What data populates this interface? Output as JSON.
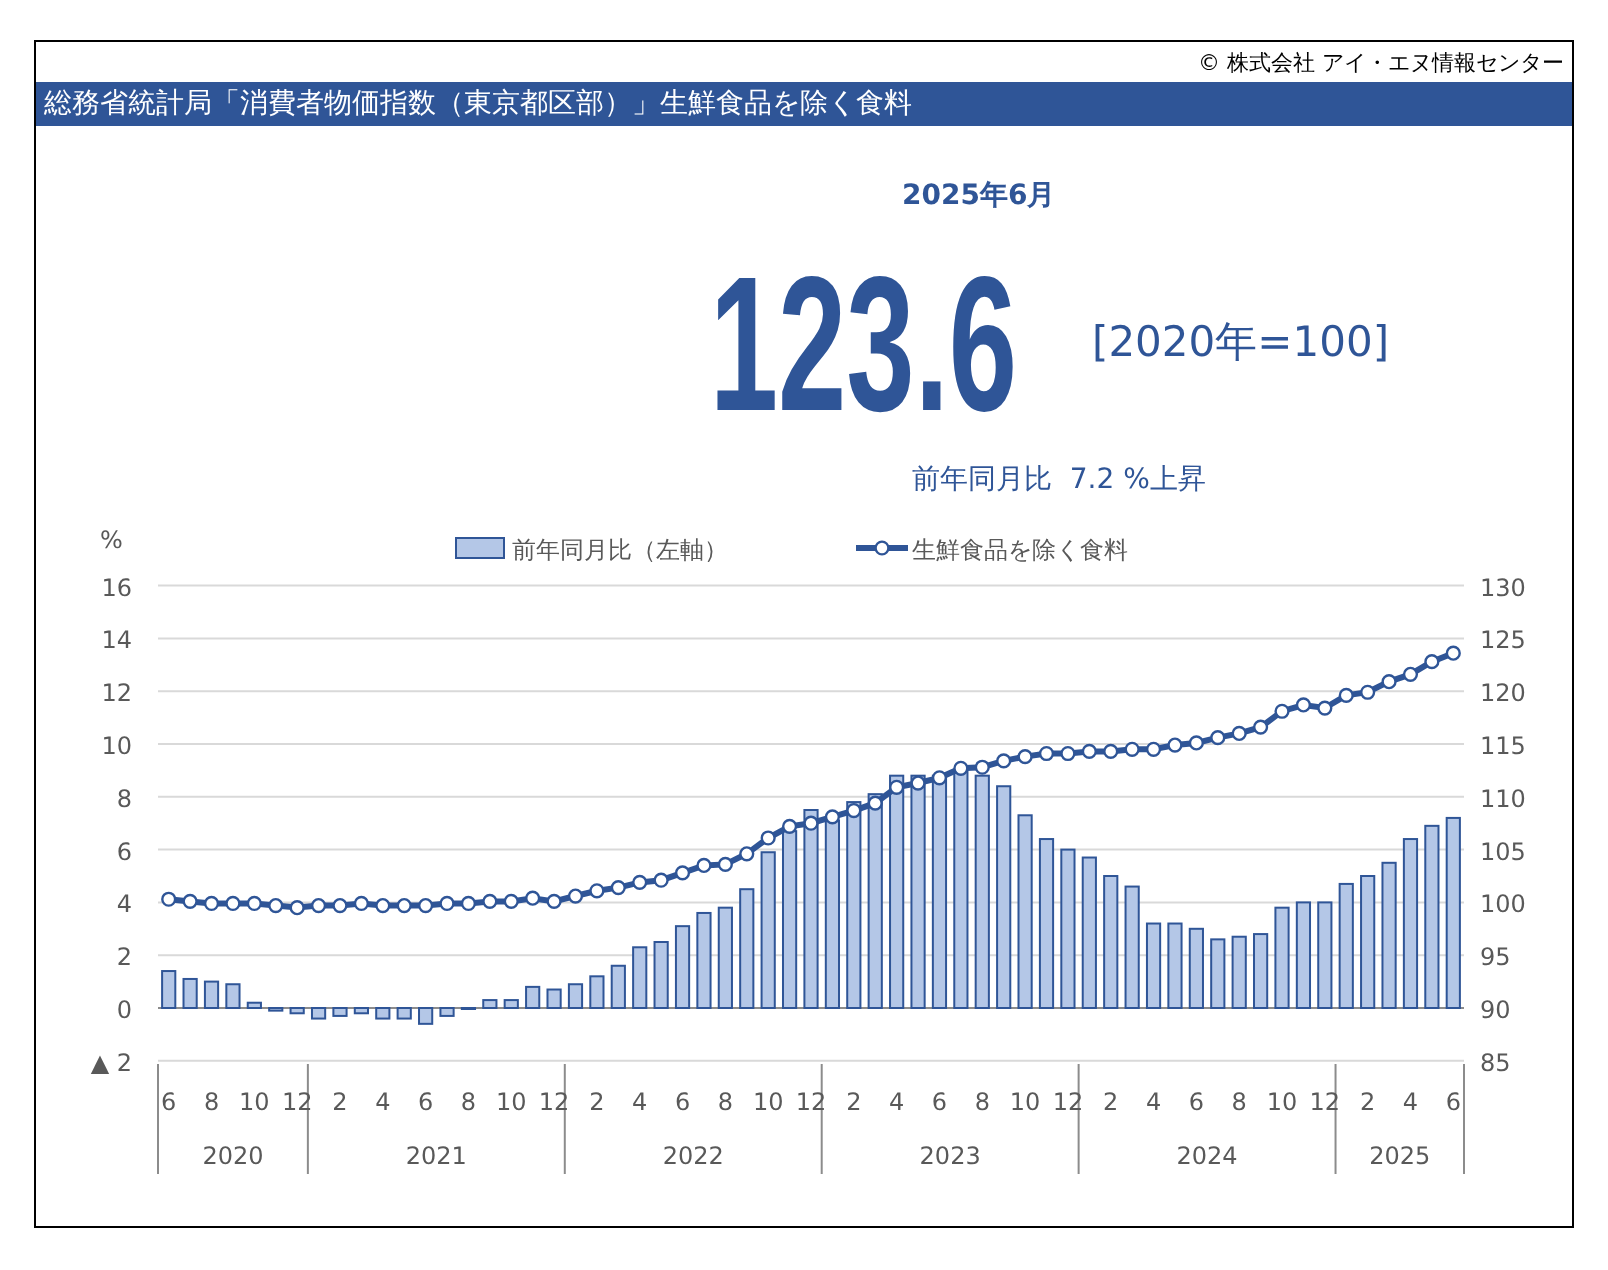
{
  "header": {
    "copyright": "© 株式会社 アイ・エヌ情報センター",
    "title": "総務省統計局「消費者物価指数（東京都区部）」生鮮食品を除く食料"
  },
  "summary": {
    "period": "2025年6月",
    "value": "123.6",
    "base": "[2020年=100]",
    "change": "前年同月比  7.2 %上昇"
  },
  "chart": {
    "unit": "%",
    "years": [
      "2020",
      "2021",
      "2022",
      "2023",
      "2024",
      "2025"
    ],
    "chart_data": {
      "type": "bar",
      "categories": [
        "6",
        null,
        "8",
        null,
        "10",
        null,
        "12",
        null,
        "2",
        null,
        "4",
        null,
        "6",
        null,
        "8",
        null,
        "10",
        null,
        "12",
        null,
        "2",
        null,
        "4",
        null,
        "6",
        null,
        "8",
        null,
        "10",
        null,
        "12",
        null,
        "2",
        null,
        "4",
        null,
        "6",
        null,
        "8",
        null,
        "10",
        null,
        "12",
        null,
        "2",
        null,
        "4",
        null,
        "6",
        null,
        "8",
        null,
        "10",
        null,
        "12",
        null,
        "2",
        null,
        "4",
        null,
        "6"
      ],
      "grid": true,
      "legend": true,
      "series": [
        {
          "name": "前年同月比（左軸）",
          "color": "#b4c7e7",
          "values": [
            1.4,
            1.1,
            1.0,
            0.9,
            0.2,
            -0.1,
            -0.2,
            -0.4,
            -0.3,
            -0.2,
            -0.4,
            -0.4,
            -0.6,
            -0.3,
            0.0,
            0.3,
            0.3,
            0.8,
            0.7,
            0.9,
            1.2,
            1.6,
            2.3,
            2.5,
            3.1,
            3.6,
            3.8,
            4.5,
            5.9,
            6.7,
            7.5,
            7.1,
            7.8,
            8.1,
            8.8,
            8.8,
            8.8,
            9.0,
            8.8,
            8.4,
            7.3,
            6.4,
            6.0,
            5.7,
            5.0,
            4.6,
            3.2,
            3.2,
            3.0,
            2.6,
            2.7,
            2.8,
            3.8,
            4.0,
            4.0,
            4.7,
            5.0,
            5.5,
            6.4,
            6.9,
            7.2
          ]
        },
        {
          "name": "生鮮食品を除く食料",
          "type": "line",
          "axis": "y2",
          "marker": "circle",
          "color": "#2f5597",
          "values": [
            100.3,
            100.1,
            99.9,
            99.9,
            99.9,
            99.7,
            99.5,
            99.7,
            99.7,
            99.9,
            99.7,
            99.7,
            99.7,
            99.9,
            99.9,
            100.1,
            100.1,
            100.4,
            100.1,
            100.6,
            101.1,
            101.4,
            101.9,
            102.1,
            102.8,
            103.5,
            103.6,
            104.6,
            106.1,
            107.2,
            107.5,
            108.1,
            108.7,
            109.4,
            110.9,
            111.3,
            111.8,
            112.7,
            112.8,
            113.4,
            113.8,
            114.1,
            114.1,
            114.3,
            114.3,
            114.5,
            114.5,
            114.9,
            115.1,
            115.6,
            116.0,
            116.6,
            118.1,
            118.7,
            118.4,
            119.6,
            119.9,
            120.9,
            121.6,
            122.8,
            123.6
          ]
        }
      ],
      "ylim": [
        -2,
        16
      ],
      "yticks": [
        {
          "value": -2,
          "label": "▲ 2"
        },
        0,
        2,
        4,
        6,
        8,
        10,
        12,
        14,
        16
      ],
      "y2lim": [
        85,
        130
      ],
      "y2ticks": [
        85,
        90,
        95,
        100,
        105,
        110,
        115,
        120,
        125,
        130
      ]
    }
  }
}
